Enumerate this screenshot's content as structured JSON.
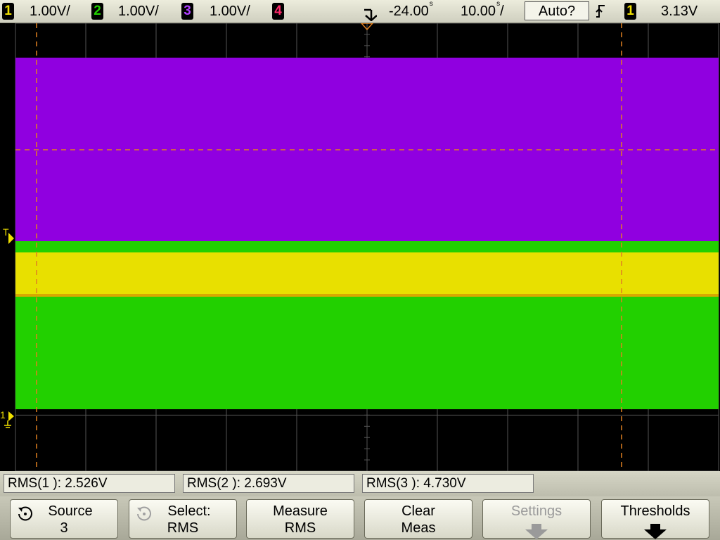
{
  "top_bar": {
    "channels": [
      {
        "id": "1",
        "scale": "1.00V/",
        "color": "#f0e000"
      },
      {
        "id": "2",
        "scale": "1.00V/",
        "color": "#22d000"
      },
      {
        "id": "3",
        "scale": "1.00V/",
        "color": "#9000e0"
      },
      {
        "id": "4",
        "scale": "",
        "color": "#ff2a6a"
      }
    ],
    "time_delay": "-24.00",
    "time_delay_unit": "s",
    "time_base": "10.00",
    "time_base_unit": "s",
    "time_base_suffix": "/",
    "trigger_mode": "Auto?",
    "trigger_source": "1",
    "trigger_level": "3.13V"
  },
  "display": {
    "trigger_marker": "T",
    "ground_marker": "1",
    "colors": {
      "ch1": "#f0e000",
      "ch2": "#22d000",
      "ch3": "#9000e0",
      "cursor": "#e08020",
      "grid": "#555555"
    }
  },
  "measurements": [
    {
      "label": "RMS(1 ): 2.526V"
    },
    {
      "label": "RMS(2 ): 2.693V"
    },
    {
      "label": "RMS(3 ): 4.730V"
    }
  ],
  "softkeys": {
    "source": {
      "line1": "Source",
      "line2": "3"
    },
    "select": {
      "line1": "Select:",
      "line2": "RMS"
    },
    "measure": {
      "line1": "Measure",
      "line2": "RMS"
    },
    "clear": {
      "line1": "Clear",
      "line2": "Meas"
    },
    "settings": {
      "line1": "Settings"
    },
    "thresholds": {
      "line1": "Thresholds"
    }
  }
}
